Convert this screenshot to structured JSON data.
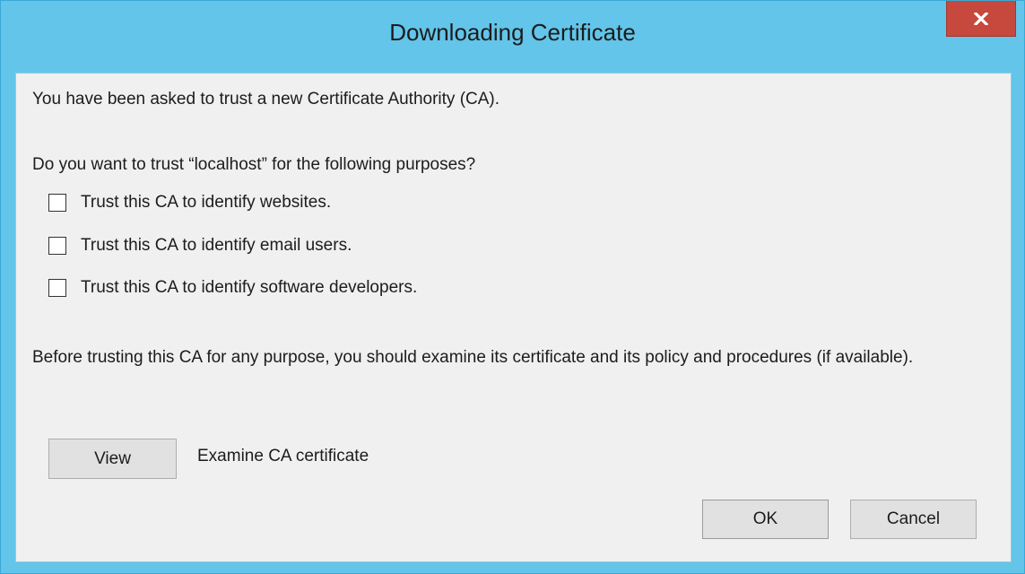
{
  "window": {
    "title": "Downloading Certificate",
    "close_icon": "close-icon"
  },
  "dialog": {
    "intro": "You have been asked to trust a new Certificate Authority (CA).",
    "question": "Do you want to trust “localhost” for the following purposes?",
    "options": [
      {
        "label": "Trust this CA to identify websites.",
        "checked": false
      },
      {
        "label": "Trust this CA to identify email users.",
        "checked": false
      },
      {
        "label": "Trust this CA to identify software developers.",
        "checked": false
      }
    ],
    "advice": "Before trusting this CA for any purpose, you should examine its certificate and its policy and procedures (if available).",
    "view_button": "View",
    "view_description": "Examine CA certificate",
    "ok_button": "OK",
    "cancel_button": "Cancel"
  },
  "colors": {
    "frame": "#62c5e9",
    "close": "#c7483d",
    "client": "#f0f0f0"
  }
}
